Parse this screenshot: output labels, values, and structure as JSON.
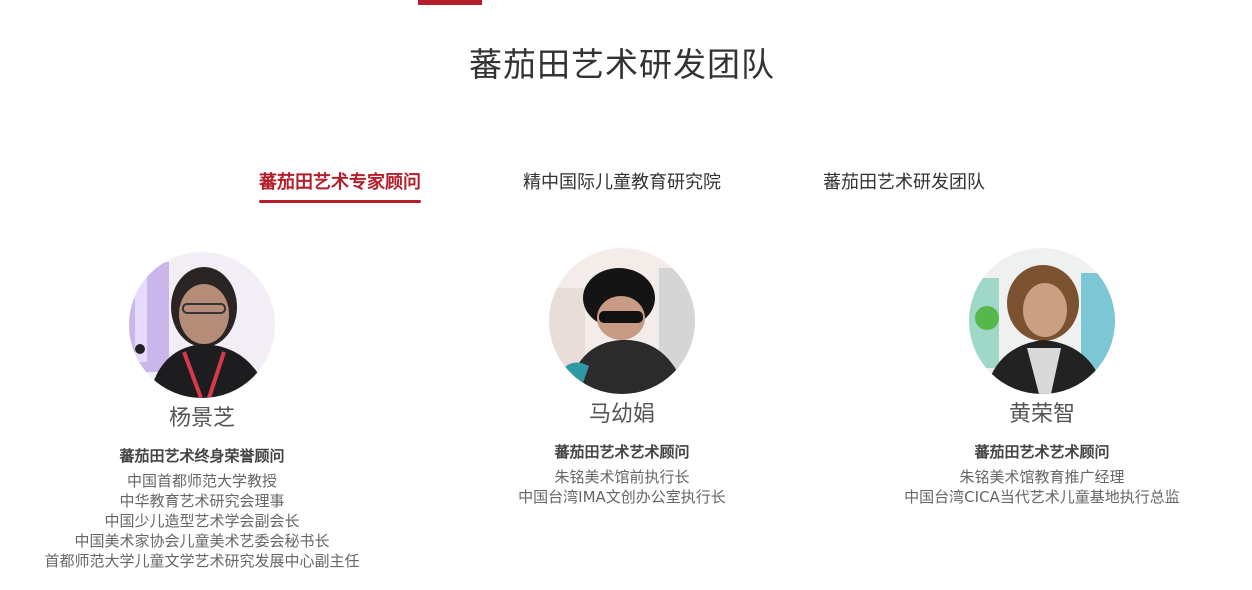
{
  "colors": {
    "accent": "#b41f2b",
    "text": "#333333"
  },
  "section": {
    "title": "蕃茄田艺术研发团队"
  },
  "tabs": [
    {
      "label": "蕃茄田艺术专家顾问",
      "active": true
    },
    {
      "label": "精中国际儿童教育研究院",
      "active": false
    },
    {
      "label": "蕃茄田艺术研发团队",
      "active": false
    }
  ],
  "members": [
    {
      "photo_icon": "portrait-photo",
      "name": "杨景芝",
      "title": "蕃茄田艺术终身荣誉顾问",
      "lines": [
        "中国首都师范大学教授",
        "中华教育艺术研究会理事",
        "中国少儿造型艺术学会副会长",
        "中国美术家协会儿童美术艺委会秘书长",
        "首都师范大学儿童文学艺术研究发展中心副主任"
      ]
    },
    {
      "photo_icon": "portrait-photo",
      "name": "马幼娟",
      "title": "蕃茄田艺术艺术顾问",
      "lines": [
        "朱铭美术馆前执行长",
        "中国台湾IMA文创办公室执行长"
      ]
    },
    {
      "photo_icon": "portrait-photo",
      "name": "黄荣智",
      "title": "蕃茄田艺术艺术顾问",
      "lines": [
        "朱铭美术馆教育推广经理",
        "中国台湾CICA当代艺术儿童基地执行总监"
      ]
    }
  ]
}
